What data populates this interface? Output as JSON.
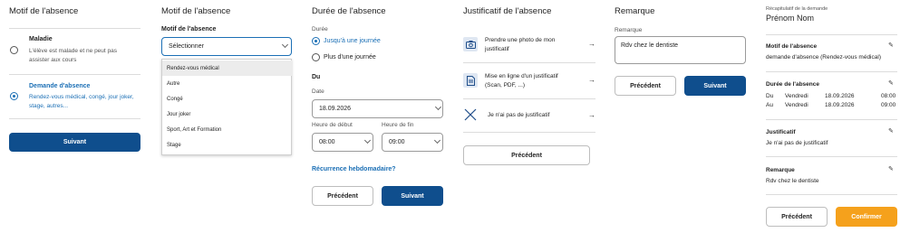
{
  "p1": {
    "title": "Motif de l'absence",
    "opt1_title": "Maladie",
    "opt1_desc": "L'élève est malade et ne peut pas assister aux cours",
    "opt2_title": "Demande d'absence",
    "opt2_desc": "Rendez-vous médical, congé, jour joker, stage, autres...",
    "next": "Suivant"
  },
  "p2": {
    "title": "Motif de l'absence",
    "label": "Motif de l'absence",
    "select_value": "Sélectionner",
    "options": [
      "Rendez-vous médical",
      "Autre",
      "Congé",
      "Jour joker",
      "Sport, Art et Formation",
      "Stage"
    ]
  },
  "p3": {
    "title": "Durée de l'absence",
    "duration_label": "Durée",
    "opt1": "Jusqu'à une journée",
    "opt2": "Plus d'une journée",
    "du": "Du",
    "date_label": "Date",
    "date_value": "18.09.2026",
    "start_label": "Heure de début",
    "start_value": "08:00",
    "end_label": "Heure de fin",
    "end_value": "09:00",
    "recurrence": "Récurrence hebdomadaire?",
    "prev": "Précédent",
    "next": "Suivant"
  },
  "p4": {
    "title": "Justificatif de l'absence",
    "item1": "Prendre une photo de mon justificatif",
    "item2": "Mise en ligne d'un justificatif (Scan, PDF, ...)",
    "item3": "Je n'ai pas de justificatif",
    "prev": "Précédent"
  },
  "p5": {
    "title": "Remarque",
    "label": "Remarque",
    "value": "Rdv chez le dentiste",
    "prev": "Précédent",
    "next": "Suivant"
  },
  "p6": {
    "caption": "Récapitulatif de la demande",
    "name": "Prénom Nom",
    "motif_title": "Motif de l'absence",
    "motif_value": "demande d'absence (Rendez-vous médical)",
    "duree_title": "Durée de l'absence",
    "row1": {
      "k": "Du",
      "day": "Vendredi",
      "date": "18.09.2026",
      "time": "08:00"
    },
    "row2": {
      "k": "Au",
      "day": "Vendredi",
      "date": "18.09.2026",
      "time": "09:00"
    },
    "just_title": "Justificatif",
    "just_value": "Je n'ai pas de justificatif",
    "rem_title": "Remarque",
    "rem_value": "Rdv chez le dentiste",
    "prev": "Précédent",
    "confirm": "Confirmer"
  },
  "colors": {
    "primary": "#0f4e8d",
    "accent": "#1b6fb5",
    "confirm": "#f5a11c"
  }
}
